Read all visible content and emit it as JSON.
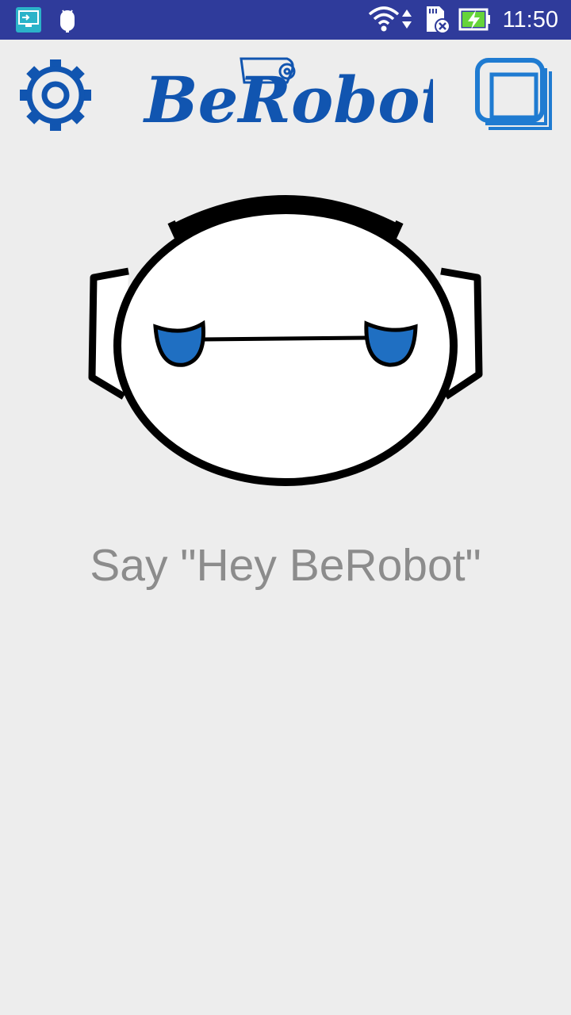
{
  "status_bar": {
    "time": "11:50",
    "icons": [
      "screen-cast-icon",
      "android-icon",
      "wifi-icon",
      "data-arrows-icon",
      "sd-card-error-icon",
      "battery-charging-icon"
    ]
  },
  "header": {
    "logo_text": "BeRobot",
    "settings_icon": "gear-icon",
    "windows_icon": "layers-icon"
  },
  "main": {
    "prompt": "Say \"Hey BeRobot\""
  },
  "colors": {
    "status_bar": "#2f3b9b",
    "brand_blue": "#1155b0",
    "eye_blue": "#1f6fc2",
    "background": "#ededed",
    "prompt_text": "#8c8c8c"
  }
}
